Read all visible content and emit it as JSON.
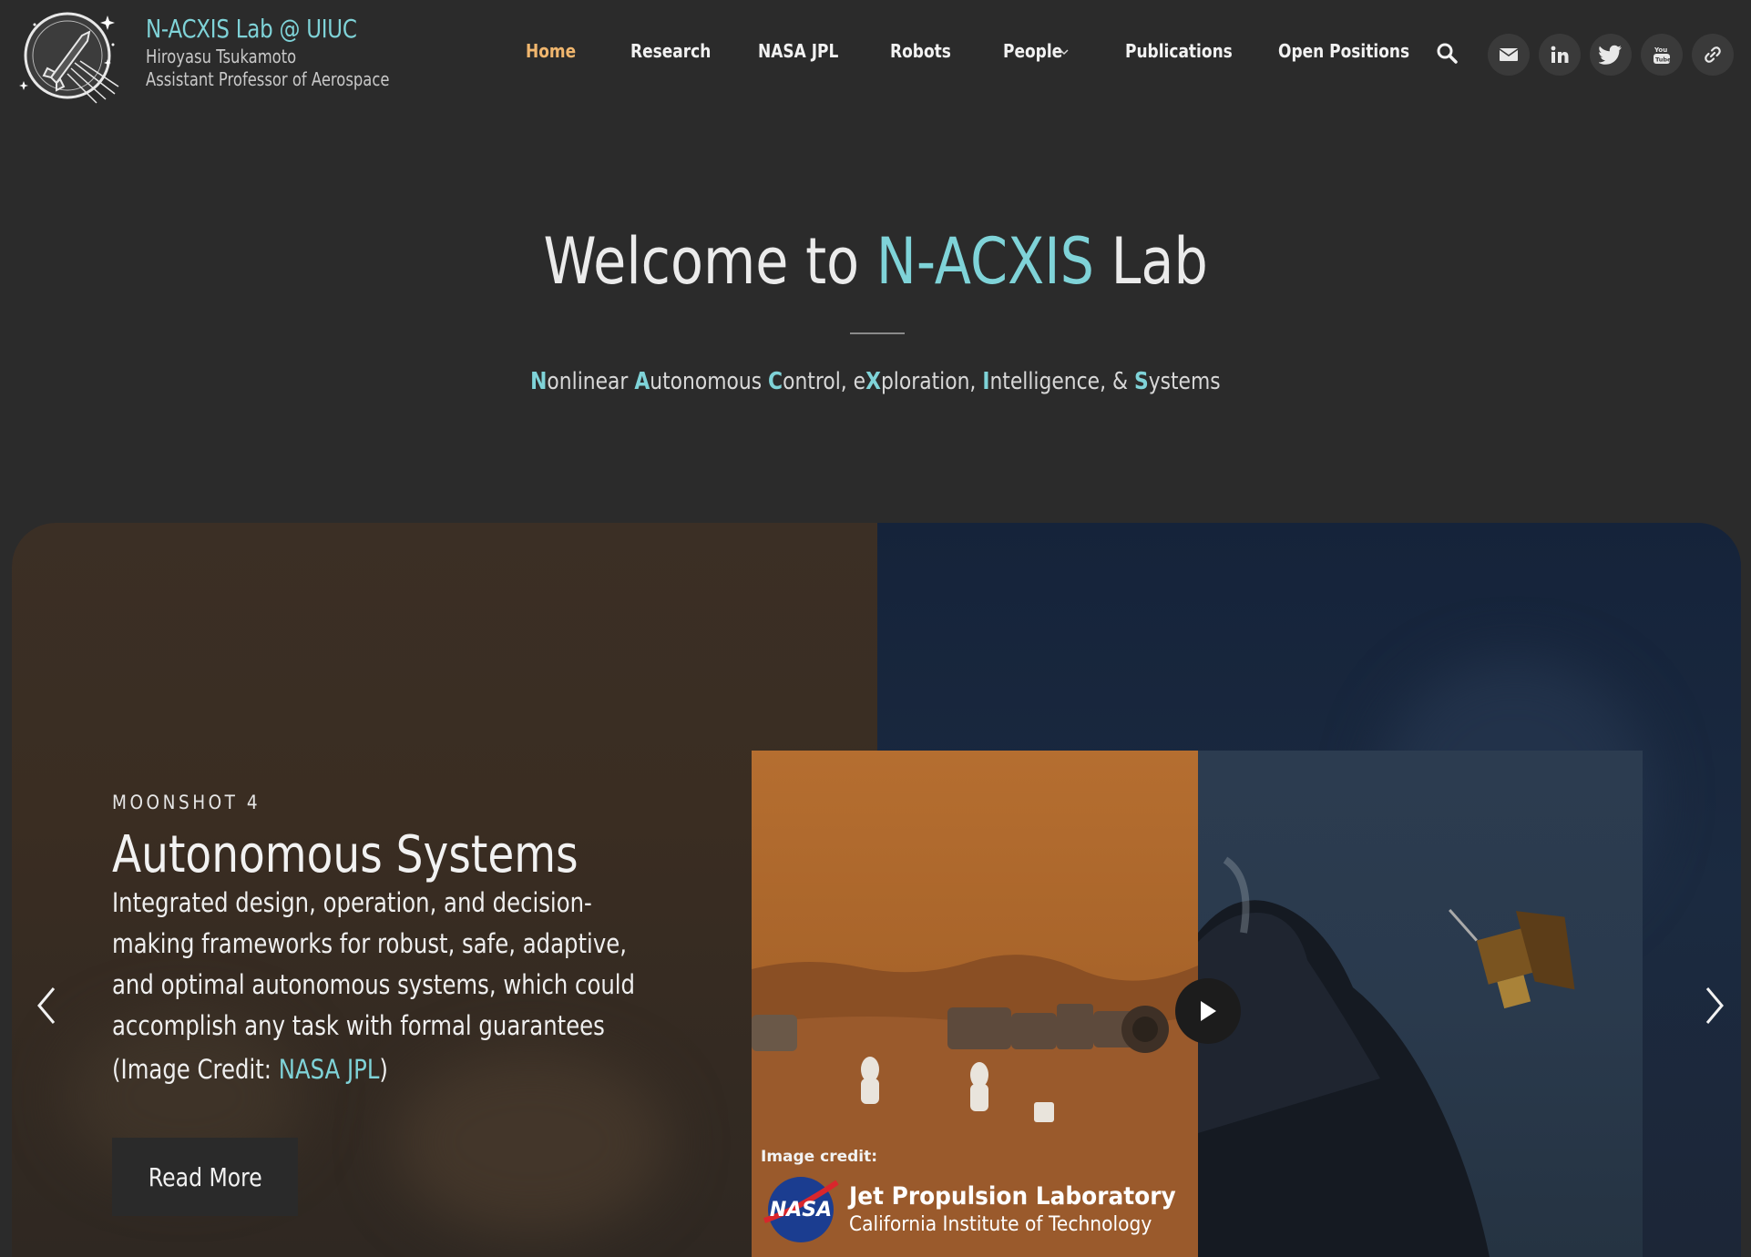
{
  "brand": {
    "title": "N-ACXIS Lab @ UIUC",
    "name": "Hiroyasu Tsukamoto",
    "position": "Assistant Professor of Aerospace"
  },
  "nav": {
    "items": [
      {
        "label": "Home",
        "active": true
      },
      {
        "label": "Research"
      },
      {
        "label": "NASA JPL"
      },
      {
        "label": "Robots"
      },
      {
        "label": "People",
        "has_dropdown": true
      },
      {
        "label": "Publications"
      },
      {
        "label": "Open Positions"
      }
    ],
    "icons": [
      "search-icon",
      "email-icon",
      "linkedin-icon",
      "twitter-icon",
      "youtube-icon",
      "link-icon"
    ]
  },
  "hero": {
    "title_before": "Welcome to ",
    "title_accent": "N-ACXIS",
    "title_after": " Lab",
    "subtitle_parts": [
      {
        "cap": "N",
        "rest": "onlinear "
      },
      {
        "cap": "A",
        "rest": "utonomous "
      },
      {
        "cap": "C",
        "rest": "ontrol, e"
      },
      {
        "cap": "X",
        "rest": "ploration, "
      },
      {
        "cap": "I",
        "rest": "ntelligence, & "
      },
      {
        "cap": "S",
        "rest": "ystems"
      }
    ]
  },
  "slide": {
    "kicker": "MOONSHOT 4",
    "title": "Autonomous Systems",
    "description": "Integrated design, operation, and decision-making frameworks for robust, safe, adaptive, and optimal autonomous systems, which could accomplish any task with formal guarantees",
    "credit_prefix": "(Image Credit: ",
    "credit_link": "NASA JPL",
    "credit_suffix": ")",
    "read_more": "Read More",
    "media": {
      "credit_label": "Image credit:",
      "logo_text": "NASA",
      "org_name": "Jet Propulsion Laboratory",
      "org_sub": "California Institute of Technology"
    }
  },
  "colors": {
    "accent": "#7fd3d8",
    "active_nav": "#f0b66e",
    "background": "#2b2b2b"
  }
}
